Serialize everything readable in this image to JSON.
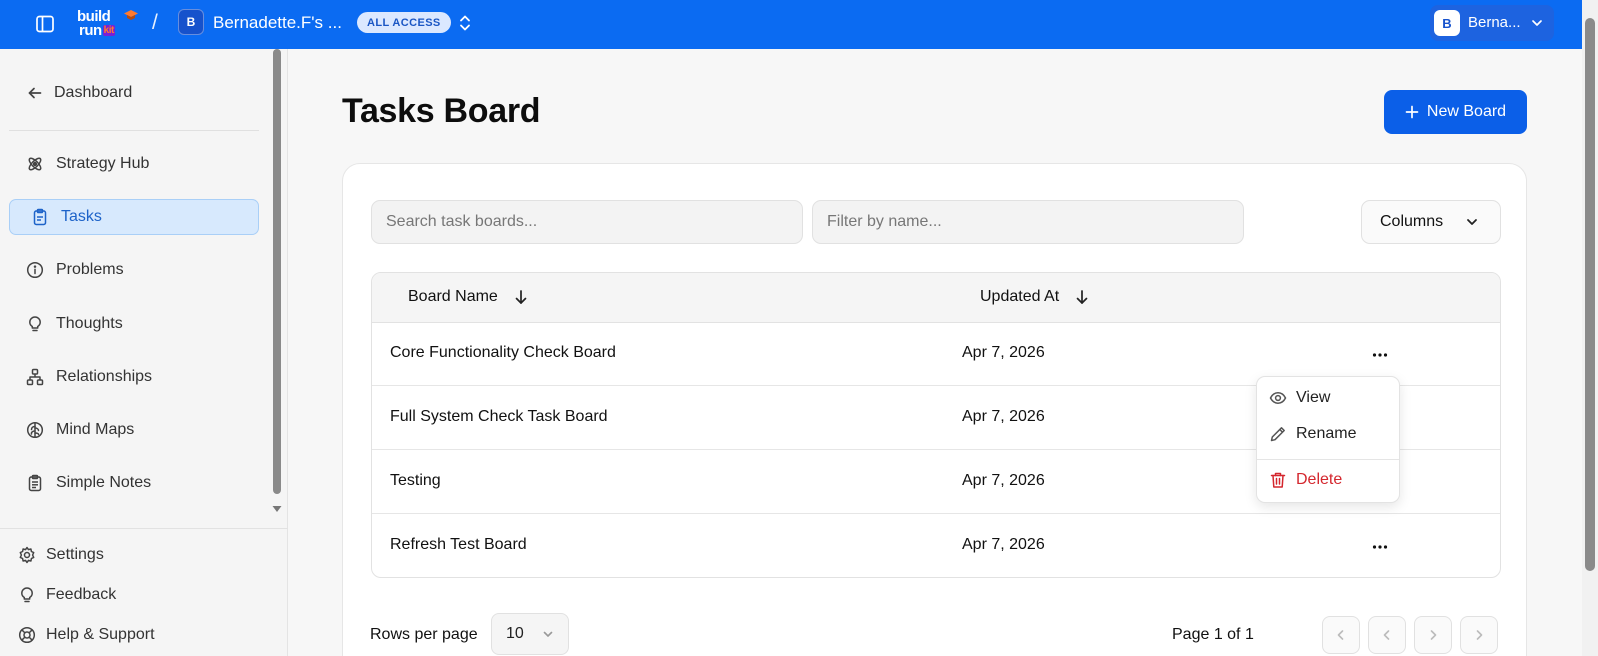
{
  "topbar": {
    "logo_line1": "build",
    "logo_line2": "run",
    "logo_kit": "kit",
    "separator": "/",
    "workspace_initial": "B",
    "workspace_name": "Bernadette.F's ...",
    "access_badge": "ALL ACCESS",
    "user_initial": "B",
    "user_name": "Berna..."
  },
  "sidebar": {
    "back_label": "Dashboard",
    "items": [
      {
        "label": "Strategy Hub",
        "icon": "atom-icon"
      },
      {
        "label": "Tasks",
        "icon": "clipboard-icon",
        "active": true
      },
      {
        "label": "Problems",
        "icon": "info-icon"
      },
      {
        "label": "Thoughts",
        "icon": "lightbulb-icon"
      },
      {
        "label": "Relationships",
        "icon": "network-icon"
      },
      {
        "label": "Mind Maps",
        "icon": "brain-icon"
      },
      {
        "label": "Simple Notes",
        "icon": "notes-icon"
      }
    ],
    "footer": [
      {
        "label": "Settings",
        "icon": "gear-icon"
      },
      {
        "label": "Feedback",
        "icon": "lightbulb-icon"
      },
      {
        "label": "Help & Support",
        "icon": "lifebuoy-icon"
      }
    ]
  },
  "main": {
    "title": "Tasks Board",
    "new_board_label": "New Board",
    "search_placeholder": "Search task boards...",
    "filter_placeholder": "Filter by name...",
    "columns_label": "Columns",
    "table": {
      "headers": [
        "Board Name",
        "Updated At"
      ],
      "rows": [
        {
          "name": "Core Functionality Check Board",
          "updated": "Apr 7, 2026"
        },
        {
          "name": "Full System Check Task Board",
          "updated": "Apr 7, 2026"
        },
        {
          "name": "Testing",
          "updated": "Apr 7, 2026"
        },
        {
          "name": "Refresh Test Board",
          "updated": "Apr 7, 2026"
        }
      ]
    },
    "rows_per_page_label": "Rows per page",
    "rows_per_page_value": "10",
    "page_info": "Page 1 of 1"
  },
  "menu": {
    "view": "View",
    "rename": "Rename",
    "delete": "Delete"
  },
  "colors": {
    "topbar": "#0b6bf2",
    "accent": "#0b5fe8",
    "active_bg": "#d7e9fd",
    "danger": "#d4272e"
  }
}
